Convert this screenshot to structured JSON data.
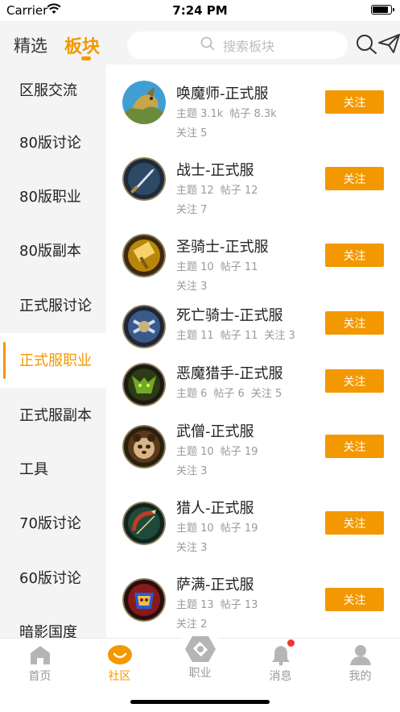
{
  "status_bar": {
    "carrier": "Carrier",
    "time": "7:24 PM",
    "battery_level": 0.85
  },
  "header": {
    "tabs": [
      {
        "label": "精选"
      },
      {
        "label": "板块"
      }
    ],
    "active_tab": "板块",
    "search_placeholder": "搜索板块"
  },
  "sidebar": {
    "items": [
      {
        "label": "区服交流"
      },
      {
        "label": "80版讨论"
      },
      {
        "label": "80版职业"
      },
      {
        "label": "80版副本"
      },
      {
        "label": "正式服讨论"
      },
      {
        "label": "正式服职业"
      },
      {
        "label": "正式服副本"
      },
      {
        "label": "工具"
      },
      {
        "label": "70版讨论"
      },
      {
        "label": "60版讨论"
      },
      {
        "label": "暗影国度"
      }
    ],
    "active_label": "正式服职业"
  },
  "boards": [
    {
      "title": "唤魔师-正式服",
      "topics": "主题 3.1k",
      "posts": "帖子 8.3k",
      "follows": "关注 5",
      "follow_label": "关注",
      "icon": "evoker-dragon-icon"
    },
    {
      "title": "战士-正式服",
      "topics": "主题 12",
      "posts": "帖子 12",
      "follows": "关注 7",
      "follow_label": "关注",
      "icon": "warrior-sword-icon"
    },
    {
      "title": "圣骑士-正式服",
      "topics": "主题 10",
      "posts": "帖子 11",
      "follows": "关注 3",
      "follow_label": "关注",
      "icon": "paladin-hammer-icon"
    },
    {
      "title": "死亡骑士-正式服",
      "topics": "主题 11",
      "posts": "帖子 11",
      "follows": "关注 3",
      "follow_label": "关注",
      "icon": "death-knight-icon"
    },
    {
      "title": "恶魔猎手-正式服",
      "topics": "主题 6",
      "posts": "帖子 6",
      "follows": "关注 5",
      "follow_label": "关注",
      "icon": "demon-hunter-icon"
    },
    {
      "title": "武僧-正式服",
      "topics": "主题 10",
      "posts": "帖子 19",
      "follows": "关注 3",
      "follow_label": "关注",
      "icon": "monk-panda-icon"
    },
    {
      "title": "猎人-正式服",
      "topics": "主题 10",
      "posts": "帖子 19",
      "follows": "关注 3",
      "follow_label": "关注",
      "icon": "hunter-bow-icon"
    },
    {
      "title": "萨满-正式服",
      "topics": "主题 13",
      "posts": "帖子 13",
      "follows": "关注 2",
      "follow_label": "关注",
      "icon": "shaman-totem-icon"
    }
  ],
  "tabbar": {
    "items": [
      {
        "label": "首页",
        "icon": "home-icon"
      },
      {
        "label": "社区",
        "icon": "community-icon"
      },
      {
        "label": "职业",
        "icon": "class-hexagon-icon"
      },
      {
        "label": "消息",
        "icon": "bell-icon"
      },
      {
        "label": "我的",
        "icon": "profile-icon"
      }
    ],
    "active_label": "社区"
  },
  "colors": {
    "accent": "#f39800",
    "sidebar_bg": "#f4f4f4",
    "meta_text": "#9a9a9a",
    "badge": "#f4342f"
  }
}
